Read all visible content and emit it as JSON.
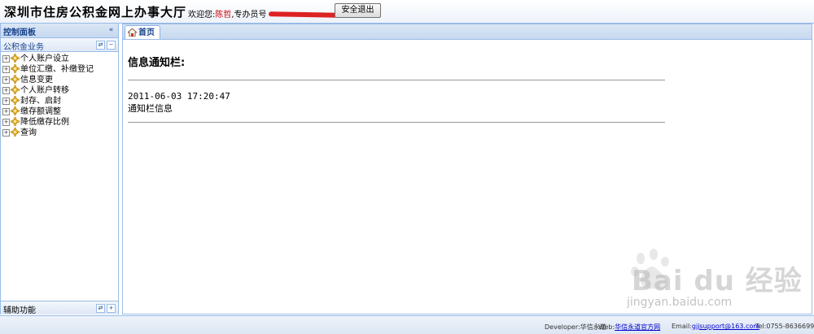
{
  "header": {
    "title": "深圳市住房公积金网上办事大厅",
    "welcome_prefix": "欢迎您:",
    "user_name": "陈哲",
    "operator_label": ",专办员号",
    "logout_label": "安全退出"
  },
  "sidebar": {
    "panel_title": "控制面板",
    "collapse_glyph": "«",
    "section_title": "公积金业务",
    "items": [
      {
        "label": "个人账户设立"
      },
      {
        "label": "单位汇缴、补缴登记"
      },
      {
        "label": "信息变更"
      },
      {
        "label": "个人账户转移"
      },
      {
        "label": "封存、启封"
      },
      {
        "label": "缴存额调整"
      },
      {
        "label": "降低缴存比例"
      },
      {
        "label": "查询"
      }
    ],
    "bottom_section_title": "辅助功能"
  },
  "main": {
    "tab_label": "首页",
    "notice_title": "信息通知栏:",
    "notice_time": "2011-06-03 17:20:47",
    "notice_body": "通知栏信息"
  },
  "footer": {
    "developer_label": "Developer:华信永道",
    "web_label": "Web:",
    "web_link": "华信永道官方网",
    "email_label": "Email:",
    "email_link": "gjjsupport@163.com",
    "tel": "Tel:0755-86366999"
  },
  "watermark": {
    "brand": "Bai du 经验",
    "url": "jingyan.baidu.com"
  },
  "colors": {
    "accent_border": "#99bbe8",
    "title_blue": "#15428b",
    "user_red": "#cc0000"
  }
}
